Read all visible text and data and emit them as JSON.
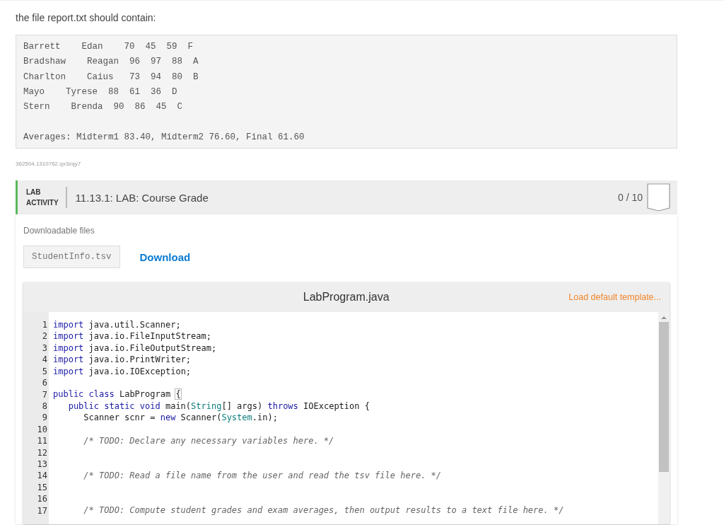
{
  "intro": "the file report.txt should contain:",
  "report": {
    "lines": [
      "Barrett    Edan    70  45  59  F",
      "Bradshaw    Reagan  96  97  88  A",
      "Charlton    Caius   73  94  80  B",
      "Mayo    Tyrese  88  61  36  D",
      "Stern    Brenda  90  86  45  C"
    ],
    "averages": "Averages: Midterm1 83.40, Midterm2 76.60, Final 61.60"
  },
  "id_text": "362504.1310762.qx3zqy7",
  "lab": {
    "badge_line1": "LAB",
    "badge_line2": "ACTIVITY",
    "title": "11.13.1: LAB: Course Grade",
    "score": "0 / 10",
    "files_label": "Downloadable files",
    "file_name": "StudentInfo.tsv",
    "download": "Download",
    "editor": {
      "file_title": "LabProgram.java",
      "template_link": "Load default template...",
      "lines": [
        {
          "number": "1",
          "kind": "top",
          "tokens": [
            {
              "kind": "keyword",
              "text": "import"
            },
            {
              "kind": "plain",
              "text": " java.util.Scanner;"
            }
          ]
        },
        {
          "number": "2",
          "kind": "top",
          "tokens": [
            {
              "kind": "keyword",
              "text": "import"
            },
            {
              "kind": "plain",
              "text": " java.io.FileInputStream;"
            }
          ]
        },
        {
          "number": "3",
          "kind": "top",
          "tokens": [
            {
              "kind": "keyword",
              "text": "import"
            },
            {
              "kind": "plain",
              "text": " java.io.FileOutputStream;"
            }
          ]
        },
        {
          "number": "4",
          "kind": "top",
          "tokens": [
            {
              "kind": "keyword",
              "text": "import"
            },
            {
              "kind": "plain",
              "text": " java.io.PrintWriter;"
            }
          ]
        },
        {
          "number": "5",
          "kind": "top",
          "tokens": [
            {
              "kind": "keyword",
              "text": "import"
            },
            {
              "kind": "plain",
              "text": " java.io.IOException;"
            }
          ]
        },
        {
          "number": "6",
          "kind": "blank"
        },
        {
          "number": "7",
          "kind": "top",
          "tokens": [
            {
              "kind": "keyword",
              "text": "public class"
            },
            {
              "kind": "plain",
              "text": " LabProgram "
            },
            {
              "kind": "bracket",
              "text": "{"
            }
          ]
        },
        {
          "number": "8",
          "kind": "member",
          "tokens": [
            {
              "kind": "keyword",
              "text": "public static void"
            },
            {
              "kind": "plain",
              "text": " main("
            },
            {
              "kind": "type",
              "text": "String"
            },
            {
              "kind": "plain",
              "text": "[] args) "
            },
            {
              "kind": "keyword",
              "text": "throws"
            },
            {
              "kind": "plain",
              "text": " IOException {"
            }
          ]
        },
        {
          "number": "9",
          "kind": "body",
          "tokens": [
            {
              "kind": "plain",
              "text": "Scanner scnr = "
            },
            {
              "kind": "keyword",
              "text": "new"
            },
            {
              "kind": "plain",
              "text": " Scanner("
            },
            {
              "kind": "type",
              "text": "System"
            },
            {
              "kind": "plain",
              "text": ".in);"
            }
          ]
        },
        {
          "number": "10",
          "kind": "blank"
        },
        {
          "number": "11",
          "kind": "body",
          "tokens": [
            {
              "kind": "comment",
              "text": "/* TODO: Declare any necessary variables here. */"
            }
          ]
        },
        {
          "number": "12",
          "kind": "blank"
        },
        {
          "number": "13",
          "kind": "blank"
        },
        {
          "number": "14",
          "kind": "body",
          "tokens": [
            {
              "kind": "comment",
              "text": "/* TODO: Read a file name from the user and read the tsv file here. */"
            }
          ]
        },
        {
          "number": "15",
          "kind": "blank"
        },
        {
          "number": "16",
          "kind": "blank"
        },
        {
          "number": "17",
          "kind": "body",
          "tokens": [
            {
              "kind": "comment",
              "text": "/* TODO: Compute student grades and exam averages, then output results to a text file here. */"
            }
          ]
        }
      ]
    }
  }
}
